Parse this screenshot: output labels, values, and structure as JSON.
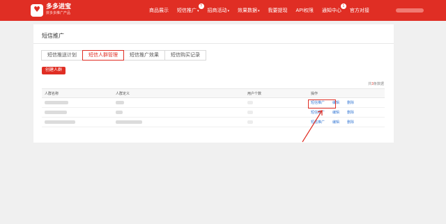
{
  "app": {
    "brand": "多多进宝",
    "brand_sub": "拼多多推广产品"
  },
  "nav": {
    "items": [
      {
        "label": "商品展示",
        "caret": false
      },
      {
        "label": "短信推广",
        "caret": true,
        "badge": "?"
      },
      {
        "label": "招商活动",
        "caret": true
      },
      {
        "label": "效果数据",
        "caret": true
      },
      {
        "label": "我要提现",
        "caret": false
      },
      {
        "label": "API权限",
        "caret": false
      },
      {
        "label": "通知中心",
        "caret": false,
        "badge": "1"
      },
      {
        "label": "官方对接",
        "caret": false
      }
    ]
  },
  "page": {
    "title": "短信推广",
    "tabs": [
      "短信推送计划",
      "短信人群管理",
      "短信推广效果",
      "短信购买记录"
    ],
    "active_tab": 1,
    "create_button": "创建人群",
    "total_prefix": "共",
    "total_count": "3",
    "total_suffix": "条数据"
  },
  "table": {
    "headers": [
      "人群名称",
      "人群定义",
      "用户个数",
      "操作"
    ],
    "row_actions": [
      "短信推广",
      "编辑",
      "删除"
    ],
    "row_count": 3
  },
  "colors": {
    "brand_red": "#e02e24",
    "link_blue": "#3a7bd5"
  }
}
